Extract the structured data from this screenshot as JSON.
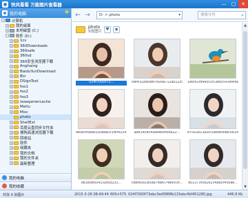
{
  "window": {
    "title": "快风看看 万能图片查看器",
    "buttons": [
      "—",
      "□",
      "✕"
    ]
  },
  "left_panel": {
    "header_label": "我的电脑",
    "tree": [
      {
        "label": "计算机",
        "toggle": "-",
        "kind": "pc"
      },
      {
        "label": "我的桌面",
        "toggle": "+",
        "kind": "folder"
      },
      {
        "label": "本地磁盘 (C:)",
        "toggle": "+",
        "kind": "drive"
      },
      {
        "label": "软件 (D:)",
        "toggle": "-",
        "kind": "drive"
      },
      {
        "label": "1cs",
        "toggle": "+",
        "kind": "folder"
      },
      {
        "label": "360Downloads",
        "toggle": "+",
        "kind": "folder"
      },
      {
        "label": "360safe",
        "toggle": "+",
        "kind": "folder"
      },
      {
        "label": "360sd",
        "toggle": "+",
        "kind": "folder"
      },
      {
        "label": "360安全浏览器下载",
        "toggle": "+",
        "kind": "folder"
      },
      {
        "label": "Anghaing",
        "toggle": "+",
        "kind": "folder"
      },
      {
        "label": "BaiduYunDownload",
        "toggle": "+",
        "kind": "folder"
      },
      {
        "label": "Bin",
        "toggle": "+",
        "kind": "folder"
      },
      {
        "label": "DSignTool",
        "toggle": "+",
        "kind": "folder"
      },
      {
        "label": "foo1",
        "toggle": "+",
        "kind": "folder"
      },
      {
        "label": "foo2",
        "toggle": "+",
        "kind": "folder"
      },
      {
        "label": "foo3",
        "toggle": "+",
        "kind": "folder"
      },
      {
        "label": "iexeqamercache",
        "toggle": "+",
        "kind": "folder"
      },
      {
        "label": "Meitu",
        "toggle": "+",
        "kind": "folder"
      },
      {
        "label": "Misc",
        "toggle": "+",
        "kind": "folder"
      },
      {
        "label": "photo",
        "toggle": "",
        "kind": "folder",
        "selected": true
      },
      {
        "label": "ShellExt",
        "toggle": "+",
        "kind": "folder"
      },
      {
        "label": "百度云盘同步文件夹",
        "toggle": "+",
        "kind": "folder"
      },
      {
        "label": "搜狗高速浏览器下载",
        "toggle": "+",
        "kind": "folder"
      },
      {
        "label": "回收站",
        "toggle": "+",
        "kind": "folder"
      },
      {
        "label": "软件",
        "toggle": "+",
        "kind": "folder"
      },
      {
        "label": "收藏夹",
        "toggle": "+",
        "kind": "folder"
      },
      {
        "label": "我的文档",
        "toggle": "+",
        "kind": "folder"
      },
      {
        "label": "我的文件夹",
        "toggle": "+",
        "kind": "folder"
      },
      {
        "label": "最新整理",
        "toggle": "+",
        "kind": "folder"
      }
    ],
    "footer": {
      "computer_label": "我的电脑",
      "favorites_label": "我的收藏"
    }
  },
  "toolbar": {
    "back": "←",
    "forward": "→",
    "path": "D: > photo",
    "search_placeholder": "搜索文件"
  },
  "folder": {
    "name": "photo",
    "count": "9张图片"
  },
  "thumbnails": [
    {
      "label": "024f7000f73...",
      "selected": true,
      "theme": "a"
    },
    {
      "label": "0df431edcbef7609a712a012cd...",
      "theme": "b"
    },
    {
      "label": "1e6f61fd4a5f1f53e6c543e4fd9...",
      "theme": "c"
    },
    {
      "label": "9e0e5f6ba6100bae1f1f6f4254515...",
      "theme": "d"
    },
    {
      "label": "a8814c80f0ea4e0f6f6822...",
      "theme": "e"
    },
    {
      "label": "b7002e13a30f1e88644ec0614...",
      "theme": "f"
    },
    {
      "label": "b8389b5041f2d5d233...",
      "theme": "g"
    },
    {
      "label": "cdbf6c81808a7fd8074a60f3f...",
      "theme": "h"
    },
    {
      "label": "d01373f5826254aa5f456ae...",
      "theme": "i"
    }
  ],
  "status": {
    "selection": "共找 9 张图片",
    "date": "2015-3-26 08:49:44",
    "dims": "600×575",
    "file": "024f7000f73abc3ed5868b115ebc4bf451280.jpg",
    "size": "446.8 Kb"
  }
}
